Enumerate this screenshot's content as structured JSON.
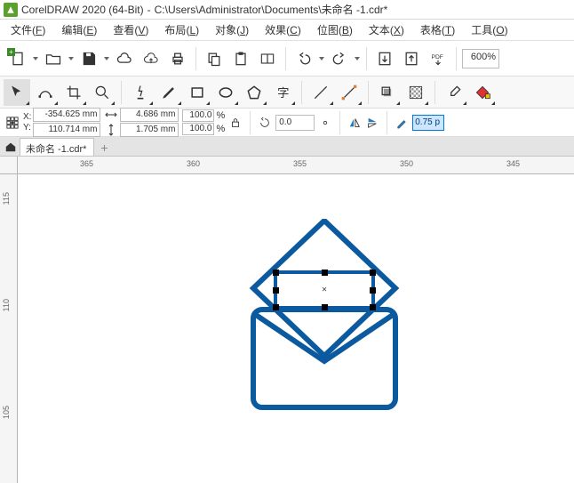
{
  "titlebar": {
    "app": "CorelDRAW 2020 (64-Bit)",
    "path": "C:\\Users\\Administrator\\Documents\\未命名 -1.cdr*"
  },
  "menu": {
    "file": {
      "label": "文件",
      "key": "F"
    },
    "edit": {
      "label": "编辑",
      "key": "E"
    },
    "view": {
      "label": "查看",
      "key": "V"
    },
    "layout": {
      "label": "布局",
      "key": "L"
    },
    "object": {
      "label": "对象",
      "key": "J"
    },
    "effect": {
      "label": "效果",
      "key": "C"
    },
    "bitmap": {
      "label": "位图",
      "key": "B"
    },
    "text": {
      "label": "文本",
      "key": "X"
    },
    "table": {
      "label": "表格",
      "key": "T"
    },
    "tools": {
      "label": "工具",
      "key": "O"
    }
  },
  "standard_toolbar": {
    "zoom": "600%"
  },
  "properties": {
    "x_label": "X:",
    "y_label": "Y:",
    "x": "-354.625 mm",
    "y": "110.714 mm",
    "w": "4.686 mm",
    "h": "1.705 mm",
    "pct_w": "100.0",
    "pct_h": "100.0",
    "pct_unit": "%",
    "rotation": "0.0",
    "outline_width": "0.75 p"
  },
  "tabs": {
    "active": "未命名 -1.cdr*"
  },
  "rulers": {
    "h": [
      "365",
      "360",
      "355",
      "350",
      "345"
    ],
    "v": [
      "115",
      "110",
      "105"
    ]
  },
  "artwork": {
    "description": "envelope-icon-selected",
    "stroke": "#0b5aa0"
  }
}
